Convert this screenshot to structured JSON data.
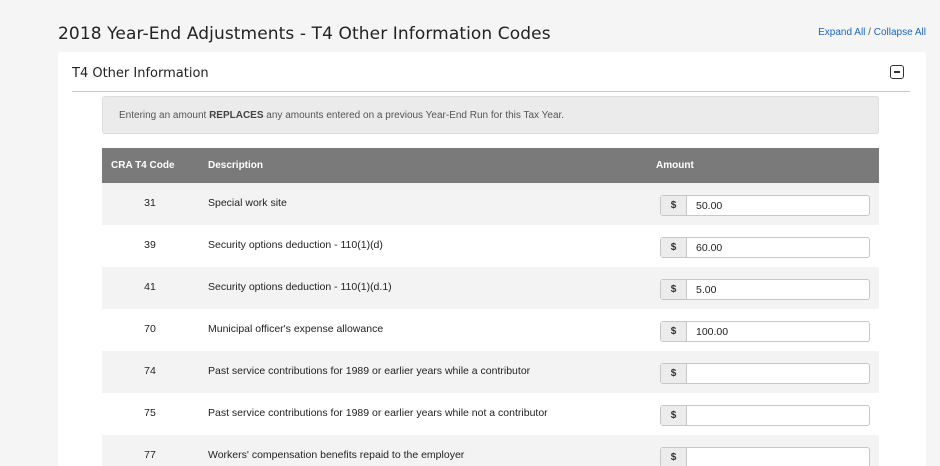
{
  "page": {
    "title": "2018 Year-End Adjustments - T4 Other Information Codes",
    "expand_all": "Expand All",
    "separator": " / ",
    "collapse_all": "Collapse All"
  },
  "panel": {
    "title": "T4 Other Information",
    "collapse_icon": "minus-square-icon",
    "notice_before": "Entering an amount ",
    "notice_bold": "REPLACES",
    "notice_after": " any amounts entered on a previous Year-End Run for this Tax Year."
  },
  "table": {
    "headers": {
      "code": "CRA T4 Code",
      "description": "Description",
      "amount": "Amount"
    },
    "currency_symbol": "$",
    "rows": [
      {
        "code": "31",
        "description": "Special work site",
        "amount": "50.00"
      },
      {
        "code": "39",
        "description": "Security options deduction - 110(1)(d)",
        "amount": "60.00"
      },
      {
        "code": "41",
        "description": "Security options deduction - 110(1)(d.1)",
        "amount": "5.00"
      },
      {
        "code": "70",
        "description": "Municipal officer's expense allowance",
        "amount": "100.00"
      },
      {
        "code": "74",
        "description": "Past service contributions for 1989 or earlier years while a contributor",
        "amount": ""
      },
      {
        "code": "75",
        "description": "Past service contributions for 1989 or earlier years while not a contributor",
        "amount": ""
      },
      {
        "code": "77",
        "description": "Workers' compensation benefits repaid to the employer",
        "amount": ""
      }
    ]
  },
  "colors": {
    "header_bg": "#7a7a7a",
    "link": "#1a66c2",
    "stripe": "#f3f3f3"
  }
}
